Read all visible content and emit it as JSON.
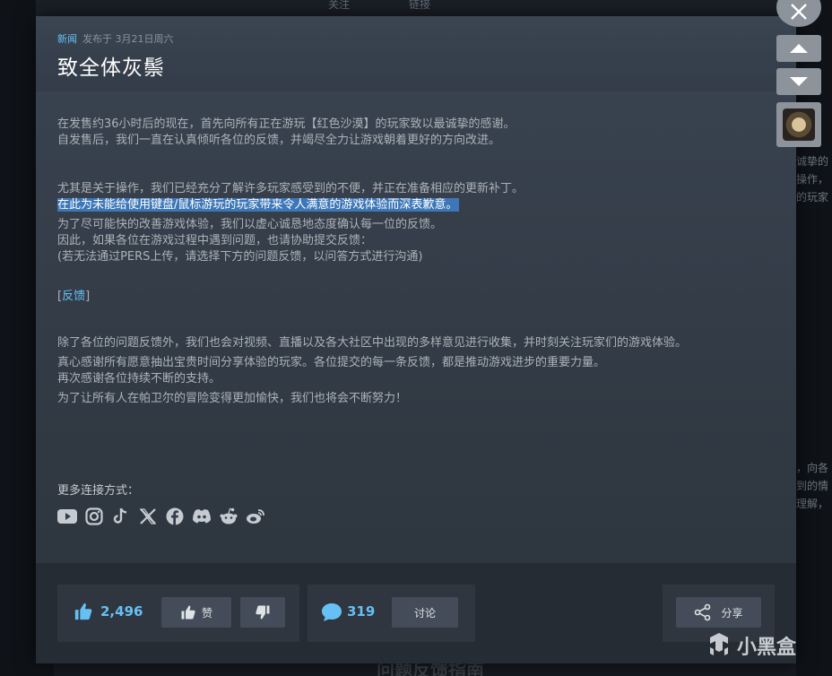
{
  "background": {
    "tab_follow": "关注",
    "tab_link": "链接",
    "right_peek": [
      "诚挚的",
      "操作，",
      "的玩家",
      "",
      "",
      "",
      "",
      "",
      "",
      "",
      "",
      "",
      "",
      "，向各",
      "到的情",
      "理解，"
    ],
    "bottom_title": "问题反馈指南"
  },
  "post": {
    "tag": "新闻",
    "published": "发布于 3月21日周六",
    "title": "致全体灰鬃"
  },
  "body": {
    "p1": [
      "在发售约36小时后的现在，首先向所有正在游玩【红色沙漠】的玩家致以最诚挚的感谢。",
      "自发售后，我们一直在认真倾听各位的反馈，并竭尽全力让游戏朝着更好的方向改进。"
    ],
    "p2": "尤其是关于操作，我们已经充分了解许多玩家感受到的不便，并正在准备相应的更新补丁。",
    "p2_highlight": "在此为未能给使用键盘/鼠标游玩的玩家带来令人满意的游戏体验而深表歉意。",
    "p3": [
      "为了尽可能快的改善游戏体验，我们以虚心诚恳地态度确认每一位的反馈。",
      "因此，如果各位在游戏过程中遇到问题，也请协助提交反馈：",
      "(若无法通过PERS上传，请选择下方的问题反馈，以问答方式进行沟通)"
    ],
    "feedback_open": "[",
    "feedback_link": "反馈",
    "feedback_close": "]",
    "p4": "除了各位的问题反馈外，我们也会对视频、直播以及各大社区中出现的多样意见进行收集，并时刻关注玩家们的游戏体验。",
    "p5": [
      "真心感谢所有愿意抽出宝贵时间分享体验的玩家。各位提交的每一条反馈，都是推动游戏进步的重要力量。",
      "再次感谢各位持续不断的支持。"
    ],
    "p6": "为了让所有人在帕卫尔的冒险变得更加愉快，我们也将会不断努力！"
  },
  "more": {
    "label": "更多连接方式：",
    "icons": [
      "youtube-icon",
      "instagram-icon",
      "tiktok-icon",
      "x-icon",
      "facebook-icon",
      "discord-icon",
      "reddit-icon",
      "weibo-icon"
    ]
  },
  "footer": {
    "likes": "2,496",
    "like_label": "赞",
    "comments": "319",
    "discuss_label": "讨论",
    "share_label": "分享"
  },
  "watermark": "小黑盒",
  "colors": {
    "accent": "#66c0f4",
    "highlight": "#3d77b7"
  }
}
